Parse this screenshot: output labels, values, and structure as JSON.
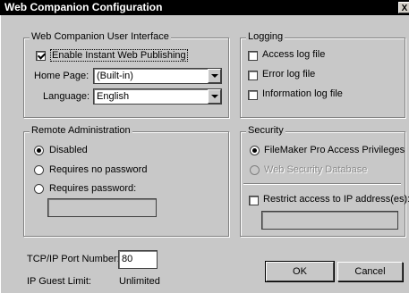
{
  "window": {
    "title": "Web Companion Configuration",
    "close_glyph": "X"
  },
  "ui_group": {
    "legend": "Web Companion User Interface",
    "enable_label": "Enable Instant Web Publishing",
    "enable_checked": true,
    "home_page_label": "Home Page:",
    "home_page_value": "(Built-in)",
    "language_label": "Language:",
    "language_value": "English"
  },
  "logging": {
    "legend": "Logging",
    "items": [
      {
        "label": "Access log file",
        "checked": false
      },
      {
        "label": "Error log file",
        "checked": false
      },
      {
        "label": "Information log file",
        "checked": false
      }
    ]
  },
  "remote_admin": {
    "legend": "Remote Administration",
    "options": [
      {
        "label": "Disabled",
        "checked": true
      },
      {
        "label": "Requires no password",
        "checked": false
      },
      {
        "label": "Requires password:",
        "checked": false
      }
    ],
    "password_value": ""
  },
  "security": {
    "legend": "Security",
    "options": [
      {
        "label": "FileMaker Pro Access Privileges",
        "checked": true,
        "enabled": true
      },
      {
        "label": "Web Security Database",
        "checked": false,
        "enabled": false
      }
    ],
    "restrict_label": "Restrict access to IP address(es):",
    "restrict_checked": false,
    "ip_value": ""
  },
  "port": {
    "label": "TCP/IP Port Number:",
    "value": "80"
  },
  "guest": {
    "label": "IP Guest Limit:",
    "value": "Unlimited"
  },
  "buttons": {
    "ok": "OK",
    "cancel": "Cancel"
  }
}
